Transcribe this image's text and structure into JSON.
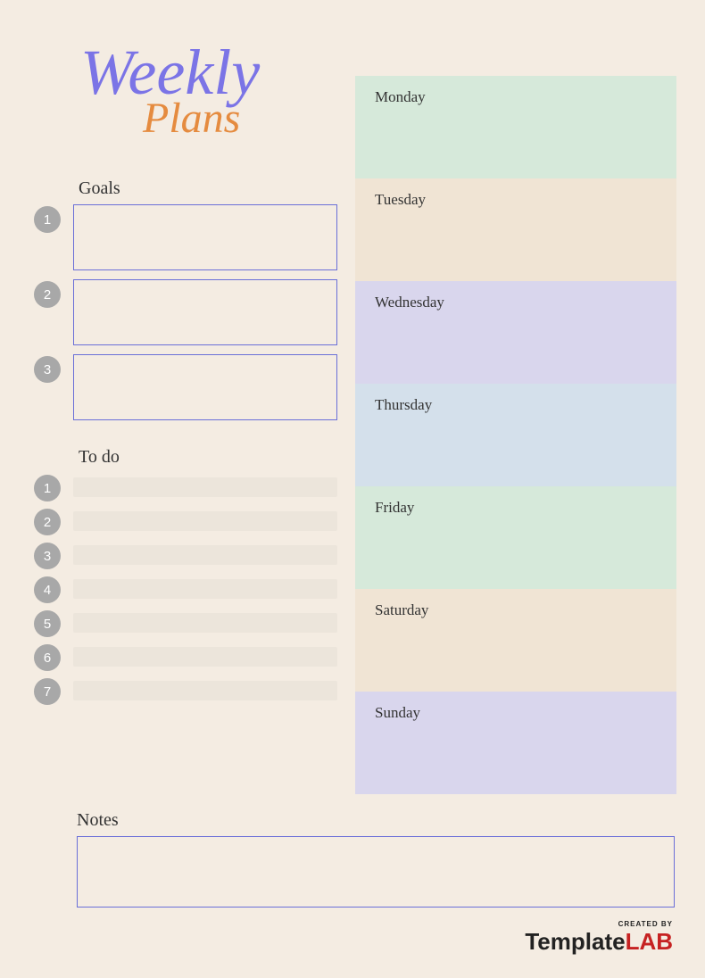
{
  "title": {
    "line1": "Weekly",
    "line2": "Plans"
  },
  "goals": {
    "label": "Goals",
    "items": [
      {
        "num": "1",
        "value": ""
      },
      {
        "num": "2",
        "value": ""
      },
      {
        "num": "3",
        "value": ""
      }
    ]
  },
  "todo": {
    "label": "To do",
    "items": [
      {
        "num": "1",
        "value": ""
      },
      {
        "num": "2",
        "value": ""
      },
      {
        "num": "3",
        "value": ""
      },
      {
        "num": "4",
        "value": ""
      },
      {
        "num": "5",
        "value": ""
      },
      {
        "num": "6",
        "value": ""
      },
      {
        "num": "7",
        "value": ""
      }
    ]
  },
  "days": [
    {
      "label": "Monday",
      "class": "day-monday"
    },
    {
      "label": "Tuesday",
      "class": "day-tuesday"
    },
    {
      "label": "Wednesday",
      "class": "day-wednesday"
    },
    {
      "label": "Thursday",
      "class": "day-thursday"
    },
    {
      "label": "Friday",
      "class": "day-friday"
    },
    {
      "label": "Saturday",
      "class": "day-saturday"
    },
    {
      "label": "Sunday",
      "class": "day-sunday"
    }
  ],
  "notes": {
    "label": "Notes",
    "value": ""
  },
  "footer": {
    "created_by": "CREATED BY",
    "brand_part1": "Template",
    "brand_part2": "LAB"
  }
}
